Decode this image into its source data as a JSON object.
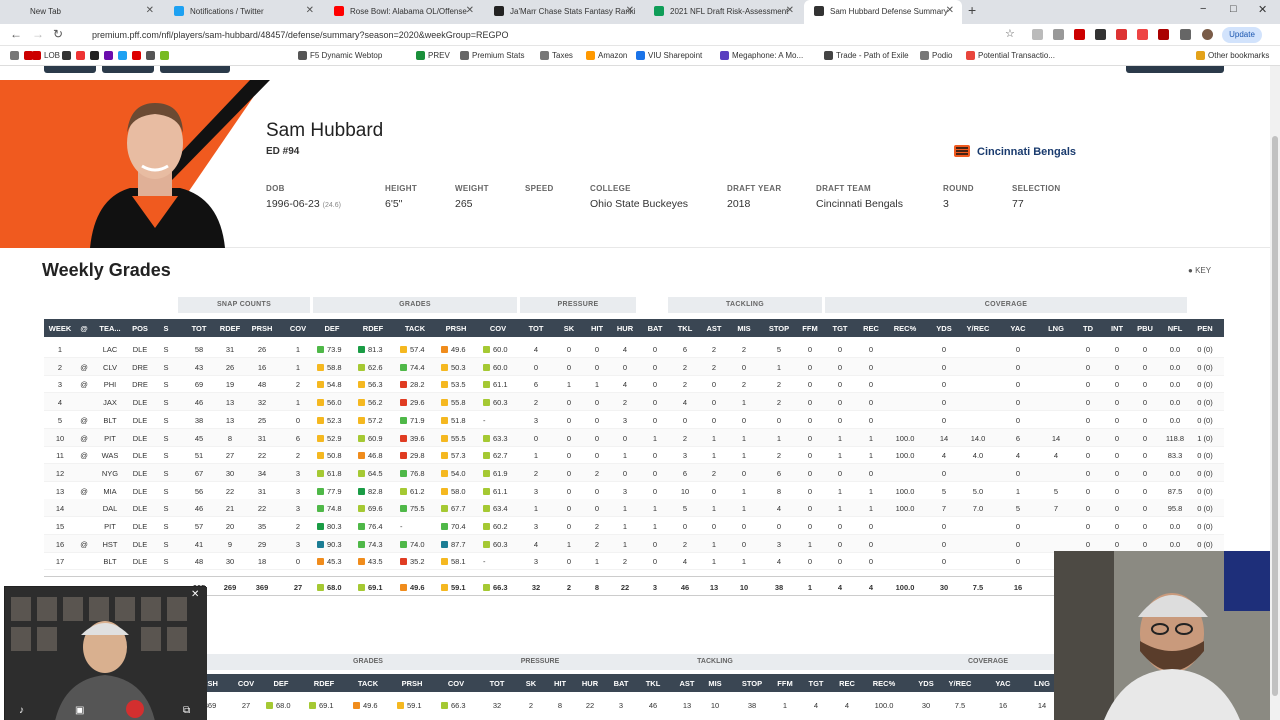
{
  "browser": {
    "tabs": [
      {
        "label": "New Tab",
        "color": "#dee1e6"
      },
      {
        "label": "Notifications / Twitter",
        "color": "#1da1f2"
      },
      {
        "label": "Rose Bowl: Alabama OL/Offense",
        "color": "#ff0000"
      },
      {
        "label": "Ja'Marr Chase Stats Fantasy Ranki",
        "color": "#222"
      },
      {
        "label": "2021 NFL Draft Risk-Assessment",
        "color": "#0f9d58"
      },
      {
        "label": "Sam Hubbard Defense Summary",
        "color": "#333"
      }
    ],
    "url": "premium.pff.com/nfl/players/sam-hubbard/48457/defense/summary?season=2020&weekGroup=REGPO",
    "update_label": "Update",
    "bookmarks": [
      "LOB",
      "F5 Dynamic Webtop",
      "PREV",
      "Premium Stats",
      "Taxes",
      "Amazon",
      "VIU Sharepoint",
      "Megaphone: A Mo...",
      "Trade - Path of Exile",
      "Podio",
      "Potential Transactio...",
      "Other bookmarks"
    ]
  },
  "player": {
    "name": "Sam Hubbard",
    "position": "ED #94",
    "team": "Cincinnati Bengals",
    "bio": {
      "dob_label": "DOB",
      "dob": "1996-06-23",
      "age": "(24.6)",
      "height_label": "HEIGHT",
      "height": "6'5\"",
      "weight_label": "WEIGHT",
      "weight": "265",
      "speed_label": "SPEED",
      "speed": "",
      "college_label": "COLLEGE",
      "college": "Ohio State Buckeyes",
      "draft_year_label": "DRAFT YEAR",
      "draft_year": "2018",
      "draft_team_label": "DRAFT TEAM",
      "draft_team": "Cincinnati Bengals",
      "round_label": "ROUND",
      "round": "3",
      "selection_label": "SELECTION",
      "selection": "77"
    }
  },
  "grades": {
    "title": "Weekly Grades",
    "key_label": "KEY",
    "groups": [
      "SNAP COUNTS",
      "GRADES",
      "PRESSURE",
      "TACKLING",
      "COVERAGE"
    ],
    "columns": [
      "WEEK",
      "@",
      "TEA...",
      "POS",
      "S",
      "TOT",
      "RDEF",
      "PRSH",
      "COV",
      "DEF",
      "RDEF",
      "TACK",
      "PRSH",
      "COV",
      "TOT",
      "SK",
      "HIT",
      "HUR",
      "BAT",
      "TKL",
      "AST",
      "MIS",
      "STOP",
      "FFM",
      "TGT",
      "REC",
      "REC%",
      "YDS",
      "Y/REC",
      "YAC",
      "LNG",
      "TD",
      "INT",
      "PBU",
      "NFL",
      "PEN"
    ],
    "rows": [
      [
        "1",
        "",
        "LAC",
        "DLE",
        "S",
        "58",
        "31",
        "26",
        "1",
        "73.9",
        "81.3",
        "57.4",
        "49.6",
        "60.0",
        "4",
        "0",
        "0",
        "4",
        "0",
        "6",
        "2",
        "2",
        "5",
        "0",
        "0",
        "0",
        "",
        "0",
        "",
        "0",
        "",
        "0",
        "0",
        "0",
        "0.0",
        "0 (0)"
      ],
      [
        "2",
        "@",
        "CLV",
        "DRE",
        "S",
        "43",
        "26",
        "16",
        "1",
        "58.8",
        "62.6",
        "74.4",
        "50.3",
        "60.0",
        "0",
        "0",
        "0",
        "0",
        "0",
        "2",
        "2",
        "0",
        "1",
        "0",
        "0",
        "0",
        "",
        "0",
        "",
        "0",
        "",
        "0",
        "0",
        "0",
        "0.0",
        "0 (0)"
      ],
      [
        "3",
        "@",
        "PHI",
        "DRE",
        "S",
        "69",
        "19",
        "48",
        "2",
        "54.8",
        "56.3",
        "28.2",
        "53.5",
        "61.1",
        "6",
        "1",
        "1",
        "4",
        "0",
        "2",
        "0",
        "2",
        "2",
        "0",
        "0",
        "0",
        "",
        "0",
        "",
        "0",
        "",
        "0",
        "0",
        "0",
        "0.0",
        "0 (0)"
      ],
      [
        "4",
        "",
        "JAX",
        "DLE",
        "S",
        "46",
        "13",
        "32",
        "1",
        "56.0",
        "56.2",
        "29.6",
        "55.8",
        "60.3",
        "2",
        "0",
        "0",
        "2",
        "0",
        "4",
        "0",
        "1",
        "2",
        "0",
        "0",
        "0",
        "",
        "0",
        "",
        "0",
        "",
        "0",
        "0",
        "0",
        "0.0",
        "0 (0)"
      ],
      [
        "5",
        "@",
        "BLT",
        "DLE",
        "S",
        "38",
        "13",
        "25",
        "0",
        "52.3",
        "57.2",
        "71.9",
        "51.8",
        "-",
        "3",
        "0",
        "0",
        "3",
        "0",
        "0",
        "0",
        "0",
        "0",
        "0",
        "0",
        "0",
        "",
        "0",
        "",
        "0",
        "",
        "0",
        "0",
        "0",
        "0.0",
        "0 (0)"
      ],
      [
        "10",
        "@",
        "PIT",
        "DLE",
        "S",
        "45",
        "8",
        "31",
        "6",
        "52.9",
        "60.9",
        "39.6",
        "55.5",
        "63.3",
        "0",
        "0",
        "0",
        "0",
        "1",
        "2",
        "1",
        "1",
        "1",
        "0",
        "1",
        "1",
        "100.0",
        "14",
        "14.0",
        "6",
        "14",
        "0",
        "0",
        "0",
        "118.8",
        "1 (0)"
      ],
      [
        "11",
        "@",
        "WAS",
        "DLE",
        "S",
        "51",
        "27",
        "22",
        "2",
        "50.8",
        "46.8",
        "29.8",
        "57.3",
        "62.7",
        "1",
        "0",
        "0",
        "1",
        "0",
        "3",
        "1",
        "1",
        "2",
        "0",
        "1",
        "1",
        "100.0",
        "4",
        "4.0",
        "4",
        "4",
        "0",
        "0",
        "0",
        "83.3",
        "0 (0)"
      ],
      [
        "12",
        "",
        "NYG",
        "DLE",
        "S",
        "67",
        "30",
        "34",
        "3",
        "61.8",
        "64.5",
        "76.8",
        "54.0",
        "61.9",
        "2",
        "0",
        "2",
        "0",
        "0",
        "6",
        "2",
        "0",
        "6",
        "0",
        "0",
        "0",
        "",
        "0",
        "",
        "0",
        "",
        "0",
        "0",
        "0",
        "0.0",
        "0 (0)"
      ],
      [
        "13",
        "@",
        "MIA",
        "DLE",
        "S",
        "56",
        "22",
        "31",
        "3",
        "77.9",
        "82.8",
        "61.2",
        "58.0",
        "61.1",
        "3",
        "0",
        "0",
        "3",
        "0",
        "10",
        "0",
        "1",
        "8",
        "0",
        "1",
        "1",
        "100.0",
        "5",
        "5.0",
        "1",
        "5",
        "0",
        "0",
        "0",
        "87.5",
        "0 (0)"
      ],
      [
        "14",
        "",
        "DAL",
        "DLE",
        "S",
        "46",
        "21",
        "22",
        "3",
        "74.8",
        "69.6",
        "75.5",
        "67.7",
        "63.4",
        "1",
        "0",
        "0",
        "1",
        "1",
        "5",
        "1",
        "1",
        "4",
        "0",
        "1",
        "1",
        "100.0",
        "7",
        "7.0",
        "5",
        "7",
        "0",
        "0",
        "0",
        "95.8",
        "0 (0)"
      ],
      [
        "15",
        "",
        "PIT",
        "DLE",
        "S",
        "57",
        "20",
        "35",
        "2",
        "80.3",
        "76.4",
        "-",
        "70.4",
        "60.2",
        "3",
        "0",
        "2",
        "1",
        "1",
        "0",
        "0",
        "0",
        "0",
        "0",
        "0",
        "0",
        "",
        "0",
        "",
        "0",
        "",
        "0",
        "0",
        "0",
        "0.0",
        "0 (0)"
      ],
      [
        "16",
        "@",
        "HST",
        "DLE",
        "S",
        "41",
        "9",
        "29",
        "3",
        "90.3",
        "74.3",
        "74.0",
        "87.7",
        "60.3",
        "4",
        "1",
        "2",
        "1",
        "0",
        "2",
        "1",
        "0",
        "3",
        "1",
        "0",
        "0",
        "",
        "0",
        "",
        "0",
        "",
        "0",
        "0",
        "0",
        "0.0",
        "0 (0)"
      ],
      [
        "17",
        "",
        "BLT",
        "DLE",
        "S",
        "48",
        "30",
        "18",
        "0",
        "45.3",
        "43.5",
        "35.2",
        "58.1",
        "-",
        "3",
        "0",
        "1",
        "2",
        "0",
        "4",
        "1",
        "1",
        "4",
        "0",
        "0",
        "0",
        "",
        "0",
        "",
        "0",
        "",
        "0",
        "0",
        "0",
        "0.0",
        "0 (0)"
      ]
    ],
    "totals": [
      "665",
      "269",
      "369",
      "27",
      "68.0",
      "69.1",
      "49.6",
      "59.1",
      "66.3",
      "32",
      "2",
      "8",
      "22",
      "3",
      "46",
      "13",
      "10",
      "38",
      "1",
      "4",
      "4",
      "100.0",
      "30",
      "7.5",
      "16"
    ],
    "bottom_groups": [
      "GRADES",
      "PRESSURE",
      "TACKLING",
      "COVERAGE"
    ],
    "bottom_columns": [
      "RSH",
      "COV",
      "DEF",
      "RDEF",
      "TACK",
      "PRSH",
      "COV",
      "TOT",
      "SK",
      "HIT",
      "HUR",
      "BAT",
      "TKL",
      "AST",
      "MIS",
      "STOP",
      "FFM",
      "TGT",
      "REC",
      "REC%",
      "YDS",
      "Y/REC",
      "YAC",
      "LNG"
    ],
    "bottom_values": [
      "369",
      "27",
      "68.0",
      "69.1",
      "49.6",
      "59.1",
      "66.3",
      "32",
      "2",
      "8",
      "22",
      "3",
      "46",
      "13",
      "10",
      "38",
      "1",
      "4",
      "4",
      "100.0",
      "30",
      "7.5",
      "16",
      "14"
    ]
  },
  "colors": {
    "excellent": "#1a9c45",
    "good": "#4fb848",
    "avg": "#a5c933",
    "below": "#f5b820",
    "poor": "#f08c1c",
    "bad": "#e03c22",
    "elite": "#1b7d94",
    "orange": "#f05a1f"
  }
}
